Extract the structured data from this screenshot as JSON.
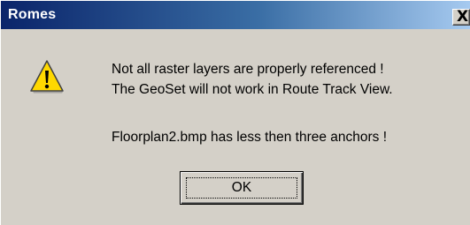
{
  "dialog": {
    "title": "Romes",
    "close_glyph": "X",
    "icon": "warning-icon",
    "message_lines": [
      "Not all raster layers are properly referenced !",
      "The GeoSet will not work in Route Track View.",
      "Floorplan2.bmp has less then three anchors !"
    ],
    "ok_label": "OK"
  },
  "colors": {
    "dialog_background": "#d4d0c8",
    "titlebar_start": "#0a246a",
    "titlebar_end": "#a6caf0",
    "warning_yellow": "#ffd800"
  }
}
